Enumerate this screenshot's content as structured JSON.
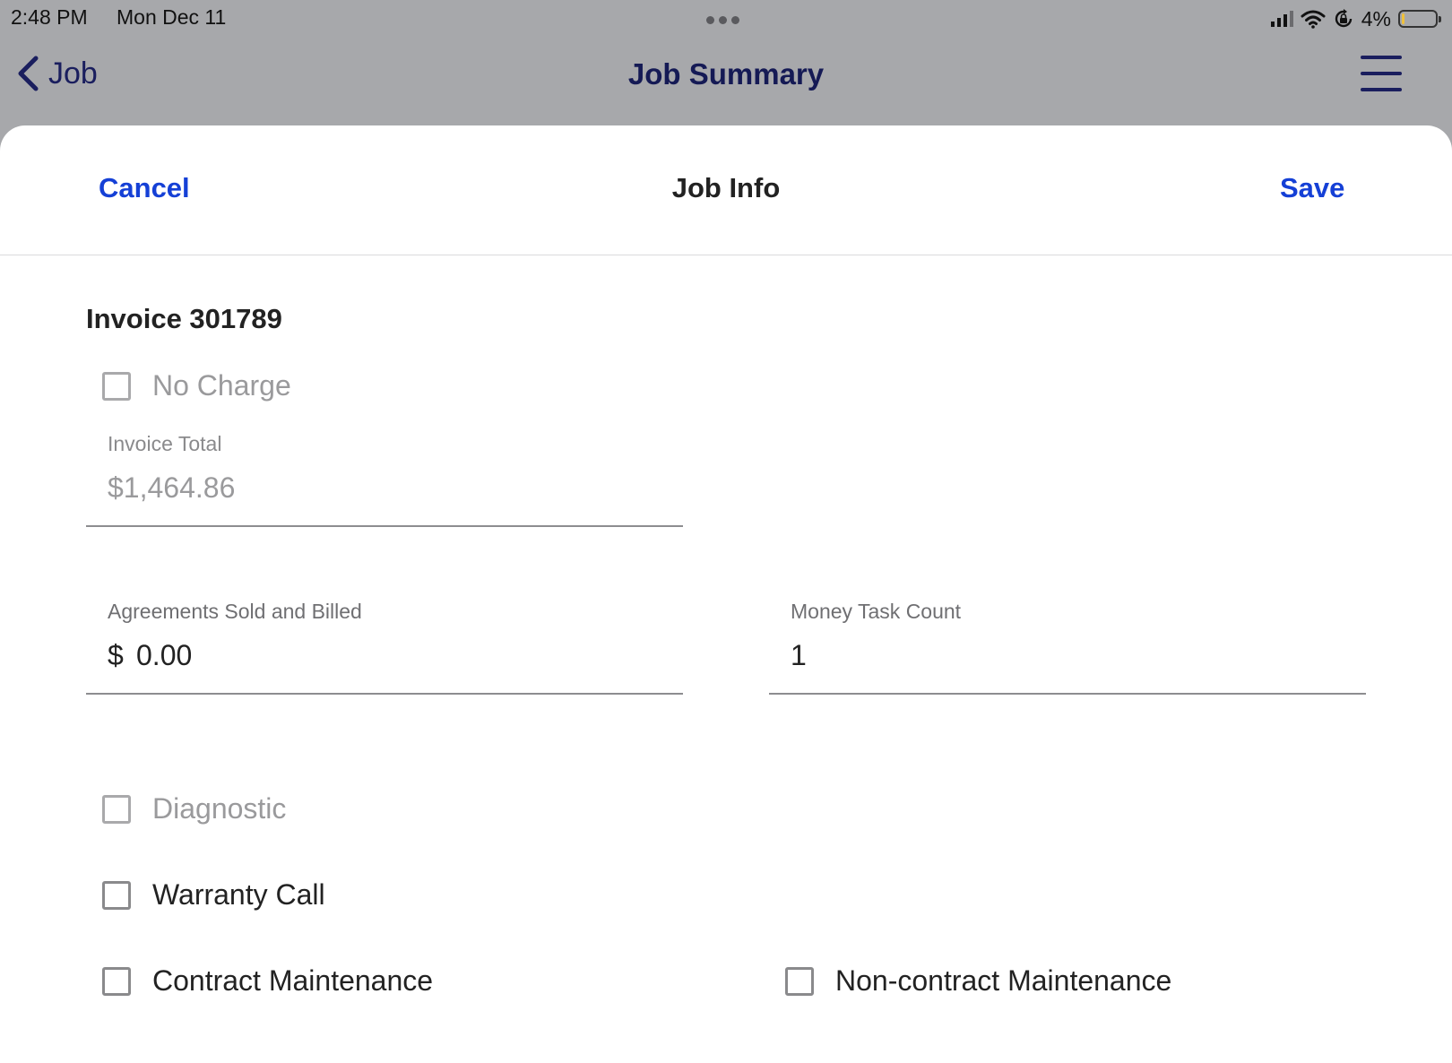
{
  "status_bar": {
    "time": "2:48 PM",
    "date": "Mon Dec 11",
    "battery_percent": "4%",
    "battery_level": 0.04
  },
  "nav": {
    "back_label": "Job",
    "title": "Job Summary",
    "back_icon": "chevron-left-icon",
    "menu_icon": "hamburger-menu-icon"
  },
  "sheet": {
    "cancel_label": "Cancel",
    "title": "Job Info",
    "save_label": "Save",
    "accent_color": "#1540d6"
  },
  "invoice": {
    "heading": "Invoice 301789",
    "no_charge_label": "No Charge",
    "total_label": "Invoice Total",
    "total_value": "$1,464.86"
  },
  "agreements": {
    "label": "Agreements Sold and Billed",
    "currency": "$",
    "value": "0.00"
  },
  "money_task": {
    "label": "Money Task Count",
    "value": "1"
  },
  "checkboxes": {
    "diagnostic": "Diagnostic",
    "warranty": "Warranty Call",
    "contract": "Contract Maintenance",
    "noncontract": "Non-contract Maintenance"
  }
}
